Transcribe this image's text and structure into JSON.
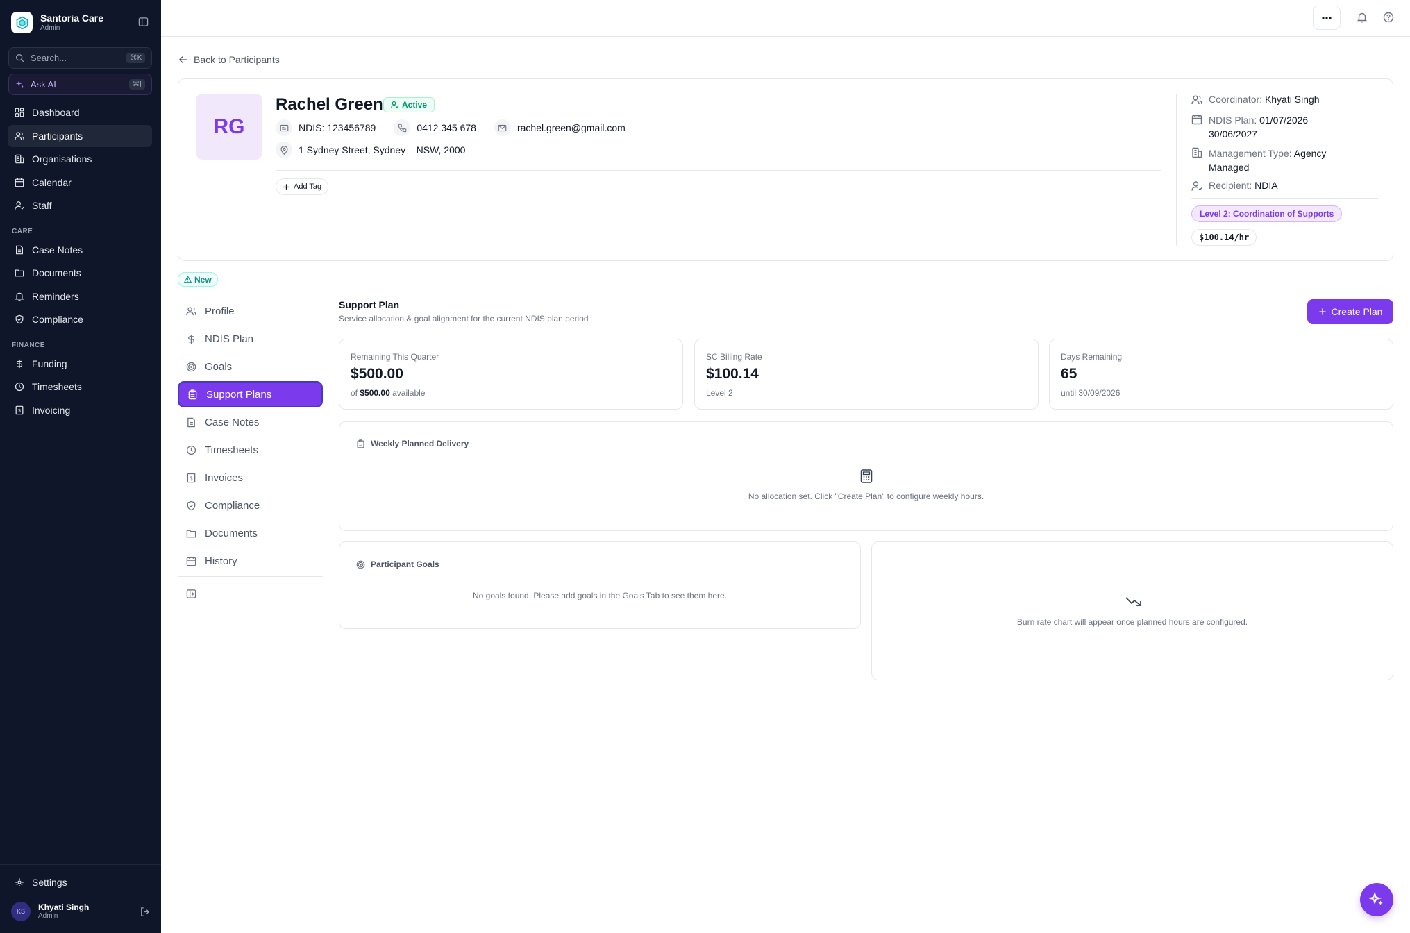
{
  "sidebar": {
    "brand_name": "Santoria Care",
    "brand_role": "Admin",
    "search_placeholder": "Search...",
    "search_shortcut": "⌘K",
    "ask_ai_label": "Ask AI",
    "ask_ai_shortcut": "⌘J",
    "items": [
      {
        "label": "Dashboard",
        "icon": "dashboard-icon"
      },
      {
        "label": "Participants",
        "icon": "users-icon",
        "active": true
      },
      {
        "label": "Organisations",
        "icon": "building-icon"
      },
      {
        "label": "Calendar",
        "icon": "calendar-icon"
      },
      {
        "label": "Staff",
        "icon": "staff-icon"
      }
    ],
    "care_label": "CARE",
    "care_items": [
      {
        "label": "Case Notes",
        "icon": "document-icon"
      },
      {
        "label": "Documents",
        "icon": "folder-icon"
      },
      {
        "label": "Reminders",
        "icon": "bell-icon"
      },
      {
        "label": "Compliance",
        "icon": "shield-icon"
      }
    ],
    "finance_label": "FINANCE",
    "finance_items": [
      {
        "label": "Funding",
        "icon": "dollar-icon"
      },
      {
        "label": "Timesheets",
        "icon": "clock-icon"
      },
      {
        "label": "Invoicing",
        "icon": "invoice-icon"
      }
    ],
    "settings_label": "Settings",
    "user": {
      "initials": "KS",
      "name": "Khyati Singh",
      "role": "Admin"
    }
  },
  "header": {
    "back_label": "Back to Participants"
  },
  "participant": {
    "initials": "RG",
    "name": "Rachel Green",
    "status": "Active",
    "ndis": "NDIS: 123456789",
    "phone": "0412 345 678",
    "email": "rachel.green@gmail.com",
    "address": "1 Sydney Street, Sydney – NSW, 2000",
    "add_tag_label": "Add Tag",
    "coordinator_label": "Coordinator:",
    "coordinator": "Khyati Singh",
    "plan_label": "NDIS Plan:",
    "plan_line1": "01/07/2026 –",
    "plan_line2": "30/06/2027",
    "management_label": "Management Type:",
    "management_line1": "Agency",
    "management_line2": "Managed",
    "recipient_label": "Recipient:",
    "recipient": "NDIA",
    "level": "Level 2: Coordination of Supports",
    "rate": "$100.14/hr"
  },
  "new_badge": "New",
  "sub_nav": [
    {
      "label": "Profile",
      "icon": "user-icon"
    },
    {
      "label": "NDIS Plan",
      "icon": "dollar-icon"
    },
    {
      "label": "Goals",
      "icon": "target-icon"
    },
    {
      "label": "Support Plans",
      "icon": "clipboard-icon",
      "active": true
    },
    {
      "label": "Case Notes",
      "icon": "document-icon"
    },
    {
      "label": "Timesheets",
      "icon": "clock-icon"
    },
    {
      "label": "Invoices",
      "icon": "invoice-icon"
    },
    {
      "label": "Compliance",
      "icon": "shield-icon"
    },
    {
      "label": "Documents",
      "icon": "folder-icon"
    },
    {
      "label": "History",
      "icon": "calendar-icon"
    }
  ],
  "support_plan": {
    "title": "Support Plan",
    "subtitle": "Service allocation & goal alignment for the current NDIS plan period",
    "create_label": "Create Plan",
    "stats": [
      {
        "label": "Remaining This Quarter",
        "value": "$500.00",
        "sub_prefix": "of",
        "sub_bold": "$500.00",
        "sub_suffix": "available"
      },
      {
        "label": "SC Billing Rate",
        "value": "$100.14",
        "sub": "Level 2"
      },
      {
        "label": "Days Remaining",
        "value": "65",
        "sub": "until 30/09/2026"
      }
    ],
    "weekly_title": "Weekly Planned Delivery",
    "weekly_empty": "No allocation set. Click \"Create Plan\" to configure weekly hours.",
    "goals_title": "Participant Goals",
    "goals_empty": "No goals found. Please add goals in the Goals Tab to see them here.",
    "burn_empty": "Burn rate chart will appear once planned hours are configured."
  },
  "colors": {
    "sidebar_bg": "#0f1629",
    "accent": "#7c3aed",
    "active_green": "#059669",
    "new_teal": "#0d9488"
  }
}
